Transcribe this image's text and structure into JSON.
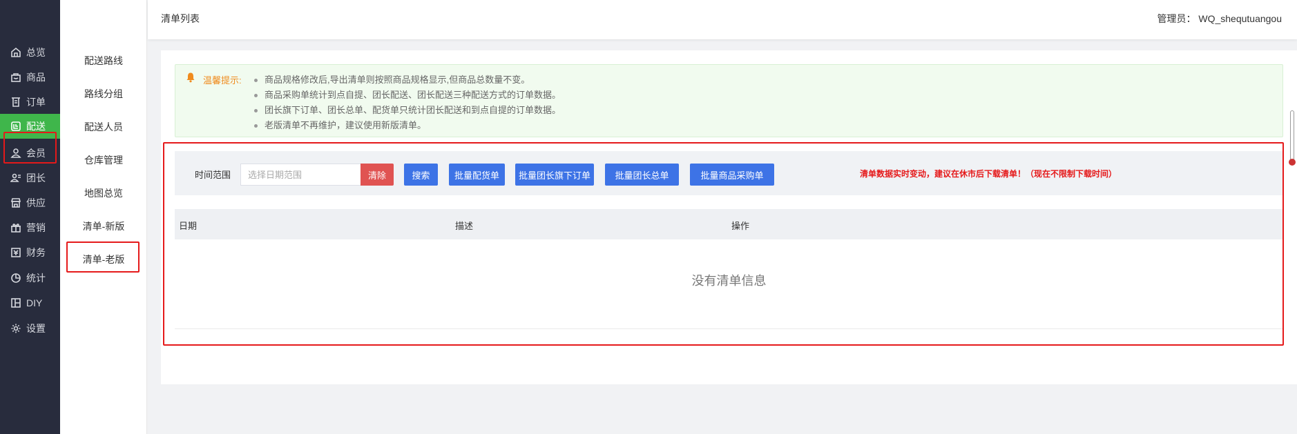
{
  "sidebar": {
    "items": [
      {
        "label": "总览",
        "icon": "home-icon"
      },
      {
        "label": "商品",
        "icon": "bag-icon"
      },
      {
        "label": "订单",
        "icon": "order-icon"
      },
      {
        "label": "配送",
        "icon": "delivery-icon"
      },
      {
        "label": "会员",
        "icon": "user-icon"
      },
      {
        "label": "团长",
        "icon": "leader-icon"
      },
      {
        "label": "供应",
        "icon": "shop-icon"
      },
      {
        "label": "营销",
        "icon": "gift-icon"
      },
      {
        "label": "财务",
        "icon": "finance-icon"
      },
      {
        "label": "统计",
        "icon": "pie-icon"
      },
      {
        "label": "DIY",
        "icon": "layout-icon"
      },
      {
        "label": "设置",
        "icon": "gear-icon"
      }
    ],
    "active_index": 3,
    "active_color": "#3fb64b"
  },
  "subnav": {
    "items": [
      "配送路线",
      "路线分组",
      "配送人员",
      "仓库管理",
      "地图总览",
      "清单-新版",
      "清单-老版"
    ],
    "selected": "清单-老版"
  },
  "header": {
    "title": "清单列表",
    "admin": "管理员： WQ_shequtuangou"
  },
  "tip": {
    "label": "温馨提示:",
    "lines": [
      "商品规格修改后,导出清单则按照商品规格显示,但商品总数量不变。",
      "商品采购单统计到点自提、团长配送、团长配送三种配送方式的订单数据。",
      "团长旗下订单、团长总单、配货单只统计团长配送和到点自提的订单数据。",
      "老版清单不再维护，建议使用新版清单。"
    ]
  },
  "filter": {
    "label": "时间范围",
    "date_placeholder": "选择日期范围",
    "clear": "清除",
    "search": "搜索",
    "btn_dispatch": "批量配货单",
    "btn_leader_orders": "批量团长旗下订单",
    "btn_leader_total": "批量团长总单",
    "btn_purchase": "批量商品采购单",
    "warning": "清单数据实时变动，建议在休市后下载清单！（现在不限制下载时间）"
  },
  "table": {
    "columns": [
      "日期",
      "描述",
      "操作"
    ],
    "empty": "没有清单信息"
  },
  "colors": {
    "primary_button": "#3d73e6",
    "danger_button": "#e05352",
    "warning_text": "#e5191a",
    "highlight_box": "#e5191a"
  }
}
